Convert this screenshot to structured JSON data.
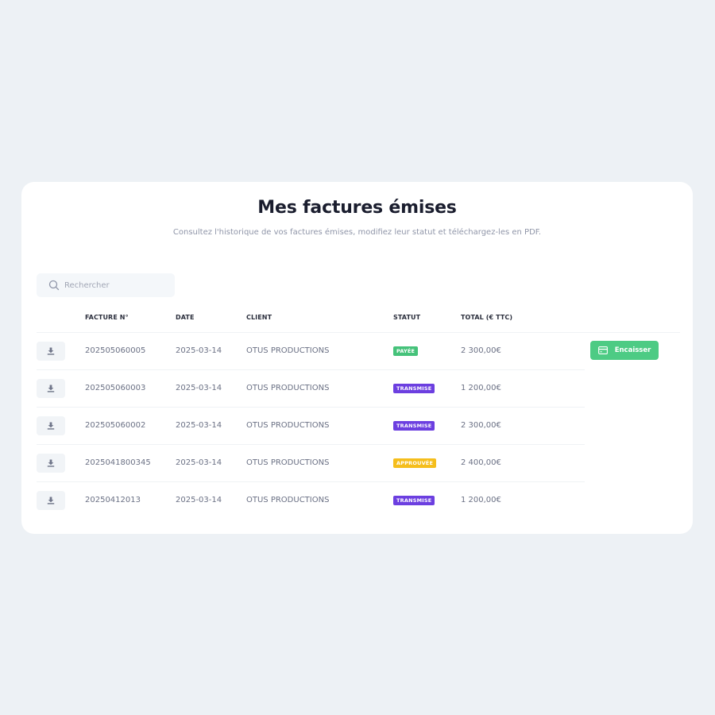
{
  "page": {
    "title": "Mes factures émises",
    "subtitle": "Consultez l'historique de vos factures émises, modifiez leur statut et téléchargez-les en PDF."
  },
  "search": {
    "placeholder": "Rechercher",
    "icon": "search-icon"
  },
  "table": {
    "columns": [
      "FACTURE N°",
      "DATE",
      "CLIENT",
      "STATUT",
      "TOTAL (€ TTC)"
    ],
    "rows": [
      {
        "number": "202505060005",
        "date": "2025-03-14",
        "client": "OTUS PRODUCTIONS",
        "status": "PAYÉE",
        "status_color": "#45c27a",
        "total": "2 300,00€",
        "action": "Encaisser"
      },
      {
        "number": "202505060003",
        "date": "2025-03-14",
        "client": "OTUS PRODUCTIONS",
        "status": "TRANSMISE",
        "status_color": "#6c3fe0",
        "total": "1 200,00€"
      },
      {
        "number": "202505060002",
        "date": "2025-03-14",
        "client": "OTUS PRODUCTIONS",
        "status": "TRANSMISE",
        "status_color": "#6c3fe0",
        "total": "2 300,00€"
      },
      {
        "number": "2025041800345",
        "date": "2025-03-14",
        "client": "OTUS PRODUCTIONS",
        "status": "APPROUVÉE",
        "status_color": "#f5be1c",
        "total": "2 400,00€"
      },
      {
        "number": "20250412013",
        "date": "2025-03-14",
        "client": "OTUS PRODUCTIONS",
        "status": "TRANSMISE",
        "status_color": "#6c3fe0",
        "total": "1 200,00€"
      }
    ]
  },
  "icons": {
    "download": "download-icon",
    "payment": "credit-card-icon"
  },
  "colors": {
    "background": "#edf1f5",
    "card": "#ffffff",
    "accent_green": "#4dcb84",
    "badge_paid": "#45c27a",
    "badge_sent": "#6c3fe0",
    "badge_approved": "#f5be1c"
  }
}
